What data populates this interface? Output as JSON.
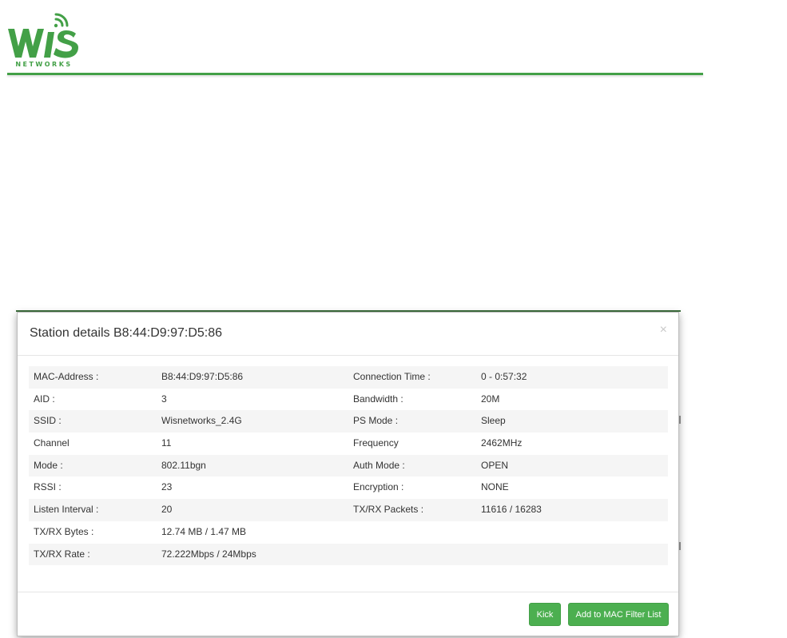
{
  "header": {
    "logo_mark": "WIS",
    "logo_sub": "NETWORKS",
    "brand_color": "#43a047"
  },
  "modal": {
    "title": "Station details B8:44:D9:97:D5:86",
    "close_glyph": "×",
    "rows": [
      {
        "l1": "MAC-Address :",
        "v1": "B8:44:D9:97:D5:86",
        "l2": "Connection Time :",
        "v2": "0 - 0:57:32"
      },
      {
        "l1": "AID :",
        "v1": "3",
        "l2": "Bandwidth :",
        "v2": "20M"
      },
      {
        "l1": "SSID :",
        "v1": "Wisnetworks_2.4G",
        "l2": "PS Mode :",
        "v2": "Sleep"
      },
      {
        "l1": "Channel",
        "v1": "11",
        "l2": "Frequency",
        "v2": "2462MHz"
      },
      {
        "l1": "Mode :",
        "v1": "802.11bgn",
        "l2": "Auth Mode :",
        "v2": "OPEN"
      },
      {
        "l1": "RSSI :",
        "v1": "23",
        "l2": "Encryption :",
        "v2": "NONE"
      },
      {
        "l1": "Listen Interval :",
        "v1": "20",
        "l2": "TX/RX Packets :",
        "v2": "11616 / 16283"
      },
      {
        "l1": "TX/RX Bytes :",
        "v1": "12.74 MB / 1.47 MB",
        "l2": "",
        "v2": ""
      },
      {
        "l1": "TX/RX Rate :",
        "v1": "72.222Mbps / 24Mbps",
        "l2": "",
        "v2": ""
      }
    ],
    "buttons": {
      "kick": "Kick",
      "filter": "Add to MAC Filter List"
    }
  }
}
